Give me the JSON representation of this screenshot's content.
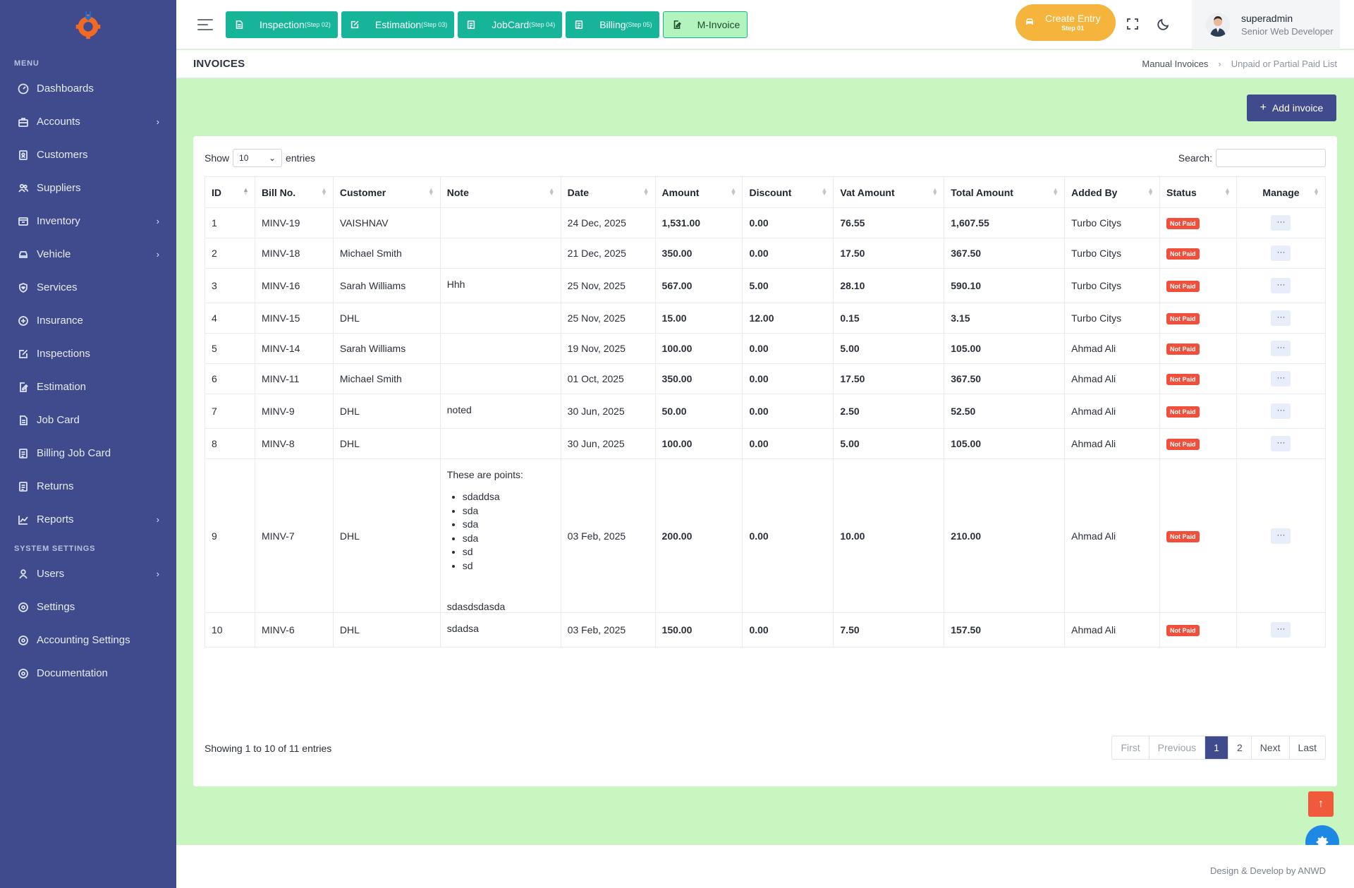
{
  "sidebar": {
    "menu_title": "MENU",
    "items": [
      {
        "label": "Dashboards",
        "icon": "dashboard-icon",
        "chevron": false
      },
      {
        "label": "Accounts",
        "icon": "briefcase-icon",
        "chevron": true
      },
      {
        "label": "Customers",
        "icon": "address-book-icon",
        "chevron": false
      },
      {
        "label": "Suppliers",
        "icon": "users-icon",
        "chevron": false
      },
      {
        "label": "Inventory",
        "icon": "inventory-icon",
        "chevron": true
      },
      {
        "label": "Vehicle",
        "icon": "car-icon",
        "chevron": true
      },
      {
        "label": "Services",
        "icon": "shield-heart-icon",
        "chevron": false
      },
      {
        "label": "Insurance",
        "icon": "insurance-icon",
        "chevron": false
      },
      {
        "label": "Inspections",
        "icon": "edit-icon",
        "chevron": false
      },
      {
        "label": "Estimation",
        "icon": "file-edit-icon",
        "chevron": false
      },
      {
        "label": "Job Card",
        "icon": "file-icon",
        "chevron": false
      },
      {
        "label": "Billing Job Card",
        "icon": "file-list-icon",
        "chevron": false
      },
      {
        "label": "Returns",
        "icon": "file-list-icon",
        "chevron": false
      },
      {
        "label": "Reports",
        "icon": "chart-line-icon",
        "chevron": true
      }
    ],
    "system_title": "SYSTEM SETTINGS",
    "system_items": [
      {
        "label": "Users",
        "icon": "user-icon",
        "chevron": true
      },
      {
        "label": "Settings",
        "icon": "settings-icon",
        "chevron": false
      },
      {
        "label": "Accounting Settings",
        "icon": "settings-icon",
        "chevron": false
      },
      {
        "label": "Documentation",
        "icon": "settings-icon",
        "chevron": false
      }
    ]
  },
  "topbar": {
    "steps": [
      {
        "label": "Inspection",
        "step": "(Step 02)",
        "style": "teal"
      },
      {
        "label": "Estimation",
        "step": "(Step 03)",
        "style": "teal"
      },
      {
        "label": "JobCard",
        "step": "(Step 04)",
        "style": "teal"
      },
      {
        "label": "Billing",
        "step": "(Step 05)",
        "style": "teal"
      },
      {
        "label": "M-Invoice",
        "step": "",
        "style": "light"
      }
    ],
    "create_entry": {
      "label": "Create Entry",
      "step": "Step 01"
    },
    "user": {
      "name": "superadmin",
      "role": "Senior Web Developer"
    }
  },
  "page": {
    "title": "INVOICES",
    "breadcrumb": {
      "parent": "Manual Invoices",
      "current": "Unpaid or Partial Paid List"
    },
    "add_button": "Add invoice"
  },
  "table_controls": {
    "show": "Show",
    "entries_value": "10",
    "entries": "entries",
    "search_label": "Search:"
  },
  "table": {
    "columns": [
      "ID",
      "Bill No.",
      "Customer",
      "Note",
      "Date",
      "Amount",
      "Discount",
      "Vat Amount",
      "Total Amount",
      "Added By",
      "Status",
      "Manage"
    ],
    "rows": [
      {
        "id": "1",
        "bill": "MINV-19",
        "customer": "VAISHNAV",
        "note": "",
        "date": "24 Dec, 2025",
        "amount": "1,531.00",
        "discount": "0.00",
        "vat": "76.55",
        "total": "1,607.55",
        "added_by": "Turbo Citys",
        "status": "Not Paid",
        "manage": "···"
      },
      {
        "id": "2",
        "bill": "MINV-18",
        "customer": "Michael Smith",
        "note": "",
        "date": "21 Dec, 2025",
        "amount": "350.00",
        "discount": "0.00",
        "vat": "17.50",
        "total": "367.50",
        "added_by": "Turbo Citys",
        "status": "Not Paid",
        "manage": "···"
      },
      {
        "id": "3",
        "bill": "MINV-16",
        "customer": "Sarah Williams",
        "note": "Hhh",
        "date": "25 Nov, 2025",
        "amount": "567.00",
        "discount": "5.00",
        "vat": "28.10",
        "total": "590.10",
        "added_by": "Turbo Citys",
        "status": "Not Paid",
        "manage": "···"
      },
      {
        "id": "4",
        "bill": "MINV-15",
        "customer": "DHL",
        "note": "",
        "date": "25 Nov, 2025",
        "amount": "15.00",
        "discount": "12.00",
        "vat": "0.15",
        "total": "3.15",
        "added_by": "Turbo Citys",
        "status": "Not Paid",
        "manage": "···"
      },
      {
        "id": "5",
        "bill": "MINV-14",
        "customer": "Sarah Williams",
        "note": "",
        "date": "19 Nov, 2025",
        "amount": "100.00",
        "discount": "0.00",
        "vat": "5.00",
        "total": "105.00",
        "added_by": "Ahmad Ali",
        "status": "Not Paid",
        "manage": "···"
      },
      {
        "id": "6",
        "bill": "MINV-11",
        "customer": "Michael Smith",
        "note": "",
        "date": "01 Oct, 2025",
        "amount": "350.00",
        "discount": "0.00",
        "vat": "17.50",
        "total": "367.50",
        "added_by": "Ahmad Ali",
        "status": "Not Paid",
        "manage": "···"
      },
      {
        "id": "7",
        "bill": "MINV-9",
        "customer": "DHL",
        "note": "noted",
        "date": "30 Jun, 2025",
        "amount": "50.00",
        "discount": "0.00",
        "vat": "2.50",
        "total": "52.50",
        "added_by": "Ahmad Ali",
        "status": "Not Paid",
        "manage": "···"
      },
      {
        "id": "8",
        "bill": "MINV-8",
        "customer": "DHL",
        "note": "",
        "date": "30 Jun, 2025",
        "amount": "100.00",
        "discount": "0.00",
        "vat": "5.00",
        "total": "105.00",
        "added_by": "Ahmad Ali",
        "status": "Not Paid",
        "manage": "···"
      },
      {
        "id": "9",
        "bill": "MINV-7",
        "customer": "DHL",
        "note": "These are points:",
        "note_list": [
          "sdaddsa",
          "sda",
          "sda",
          "sda",
          "sd",
          "sd"
        ],
        "note_after": "sdasdsdasda",
        "date": "03 Feb, 2025",
        "amount": "200.00",
        "discount": "0.00",
        "vat": "10.00",
        "total": "210.00",
        "added_by": "Ahmad Ali",
        "status": "Not Paid",
        "manage": "···"
      },
      {
        "id": "10",
        "bill": "MINV-6",
        "customer": "DHL",
        "note": "sdadsa",
        "date": "03 Feb, 2025",
        "amount": "150.00",
        "discount": "0.00",
        "vat": "7.50",
        "total": "157.50",
        "added_by": "Ahmad Ali",
        "status": "Not Paid",
        "manage": "···"
      }
    ]
  },
  "pagination": {
    "info": "Showing 1 to 10 of 11 entries",
    "first": "First",
    "previous": "Previous",
    "pages": [
      "1",
      "2"
    ],
    "active_page": "1",
    "next": "Next",
    "last": "Last"
  },
  "footer": {
    "text": "Design & Develop by ANWD"
  },
  "colors": {
    "sidebar": "#3f4b8c",
    "teal": "#16b59a",
    "page_bg": "#c8f5c0",
    "badge": "#f14f3b",
    "create_entry": "#f5b43b"
  }
}
